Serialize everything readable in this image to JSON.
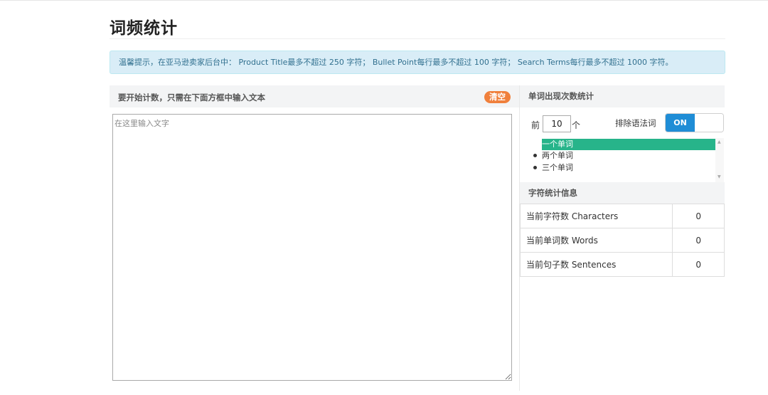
{
  "page": {
    "title": "词频统计"
  },
  "alert": {
    "text": "温馨提示，在亚马逊卖家后台中：    Product Title最多不超过 250 字符；    Bullet Point每行最多不超过 100 字符；    Search Terms每行最多不超过 1000 字符。"
  },
  "input_panel": {
    "header": "要开始计数，只需在下面方框中输入文本",
    "clear_label": "清空",
    "textarea_value": "",
    "textarea_placeholder": "在这里输入文字"
  },
  "word_freq": {
    "header": "单词出现次数统计",
    "prefix_label": "前",
    "top_n_value": "10",
    "suffix_label": "个",
    "exclude_grammar_label": "排除语法词",
    "toggle_on_label": "ON",
    "options": [
      "一个单词",
      "两个单词",
      "三个单词"
    ],
    "selected_option": "一个单词"
  },
  "char_stats": {
    "header": "字符统计信息",
    "rows": [
      {
        "label": "当前字符数 Characters",
        "value": "0"
      },
      {
        "label": "当前单词数 Words",
        "value": "0"
      },
      {
        "label": "当前句子数 Sentences",
        "value": "0"
      }
    ]
  },
  "colors": {
    "alert_bg": "#d9edf7",
    "alert_text": "#31708f",
    "clear_button": "#f0803c",
    "toggle_on": "#1f8dd6",
    "selected_item": "#27b48a"
  }
}
